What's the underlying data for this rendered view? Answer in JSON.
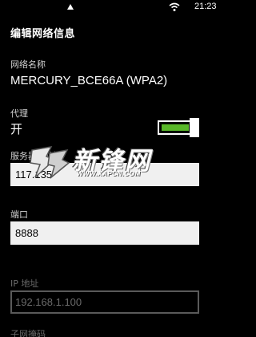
{
  "status_bar": {
    "time": "21:23",
    "icons": [
      "signal-icon",
      "wifi-icon"
    ]
  },
  "page": {
    "title": "编辑网络信息"
  },
  "network_name": {
    "label": "网络名称",
    "value": "MERCURY_BCE66A (WPA2)"
  },
  "proxy": {
    "label": "代理",
    "state_label": "开",
    "enabled": true,
    "accent_color": "#59b829"
  },
  "server": {
    "label": "服务器/网址",
    "value": "117.135"
  },
  "port": {
    "label": "端口",
    "value": "8888"
  },
  "ip_address": {
    "label": "IP 地址",
    "value": "192.168.1.100",
    "disabled": true
  },
  "subnet_mask": {
    "label": "子网掩码",
    "disabled": true
  },
  "watermark": {
    "title": "新锋网",
    "url": "WWW.XAPCN.COM"
  }
}
